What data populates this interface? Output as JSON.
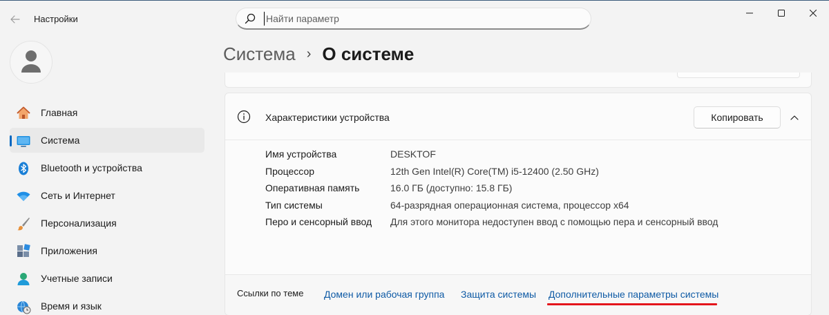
{
  "app": {
    "title": "Настройки"
  },
  "search": {
    "placeholder": "Найти параметр"
  },
  "sidebar": {
    "items": [
      {
        "label": "Главная",
        "icon": "home-icon"
      },
      {
        "label": "Система",
        "icon": "system-icon",
        "active": true
      },
      {
        "label": "Bluetooth и устройства",
        "icon": "bluetooth-icon"
      },
      {
        "label": "Сеть и Интернет",
        "icon": "wifi-icon"
      },
      {
        "label": "Персонализация",
        "icon": "brush-icon"
      },
      {
        "label": "Приложения",
        "icon": "apps-icon"
      },
      {
        "label": "Учетные записи",
        "icon": "account-icon"
      },
      {
        "label": "Время и язык",
        "icon": "globe-clock-icon"
      }
    ]
  },
  "breadcrumb": {
    "parent": "Система",
    "separator": "›",
    "current": "О системе"
  },
  "device_card": {
    "title": "Характеристики устройства",
    "copy_label": "Копировать",
    "specs": [
      {
        "label": "Имя устройства",
        "value": "DESKTOF"
      },
      {
        "label": "Процессор",
        "value": "12th Gen Intel(R) Core(TM) i5-12400 (2.50 GHz)"
      },
      {
        "label": "Оперативная память",
        "value": "16.0 ГБ (доступно: 15.8 ГБ)"
      },
      {
        "label": "Тип системы",
        "value": "64-разрядная операционная система, процессор x64"
      },
      {
        "label": "Перо и сенсорный ввод",
        "value": "Для этого монитора недоступен ввод с помощью пера и сенсорный ввод"
      }
    ]
  },
  "related": {
    "label": "Ссылки по теме",
    "links": [
      "Домен или рабочая группа",
      "Защита системы",
      "Дополнительные параметры системы"
    ]
  },
  "colors": {
    "accent": "#0067c0",
    "link": "#0e5aa5",
    "highlight": "#e4151c"
  }
}
